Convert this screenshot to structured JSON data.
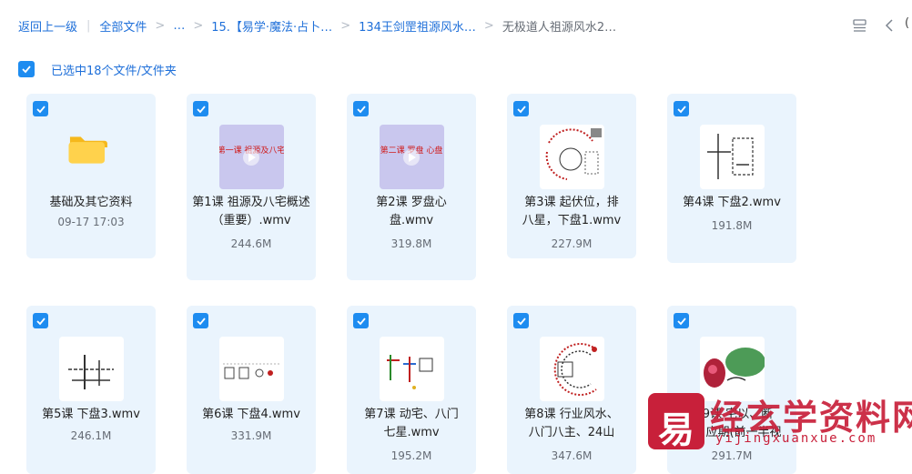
{
  "breadcrumb": {
    "back": "返回上一级",
    "all_files": "全部文件",
    "ellipsis": "…",
    "crumb1": "15.【易学·魔法·占卜…",
    "crumb2": "134王剑罡祖源风水…",
    "current": "无极道人祖源风水2…"
  },
  "header_cut_text": "(",
  "selection": {
    "text": "已选中18个文件/文件夹",
    "checked": true
  },
  "files": [
    {
      "name": "基础及其它资料",
      "meta": "09-17 17:03",
      "kind": "folder",
      "thumb_text": ""
    },
    {
      "name": "第1课 祖源及八宅概述（重要）.wmv",
      "meta": "244.6M",
      "kind": "video-title",
      "thumb_text": "第一课 祖源及八宅"
    },
    {
      "name": "第2课 罗盘心盘.wmv",
      "meta": "319.8M",
      "kind": "video-title",
      "thumb_text": "第二课 罗盘 心盘"
    },
    {
      "name": "第3课 起伏位，排八星，下盘1.wmv",
      "meta": "227.9M",
      "kind": "video-diagram"
    },
    {
      "name": "第4课 下盘2.wmv",
      "meta": "191.8M",
      "kind": "video-sketch"
    },
    {
      "name": "第5课 下盘3.wmv",
      "meta": "246.1M",
      "kind": "video-sketch"
    },
    {
      "name": "第6课 下盘4.wmv",
      "meta": "331.9M",
      "kind": "video-sketch"
    },
    {
      "name": "第7课 动宅、八门七星.wmv",
      "meta": "195.2M",
      "kind": "video-color"
    },
    {
      "name": "第8课 行业风水、八门八主、24山",
      "meta": "347.6M",
      "kind": "video-diagram"
    },
    {
      "name": "第9课 宅以、断事、应期(前一半视",
      "meta": "291.7M",
      "kind": "video-photo"
    }
  ],
  "watermark": {
    "logo_char": "易",
    "title": "经玄学资料网",
    "subtitle": "yijingxuanxue.com"
  },
  "colors": {
    "accent": "#1e8cf0",
    "card_bg": "#eaf4fd",
    "link": "#1e6fd9",
    "watermark": "#c8203a"
  }
}
